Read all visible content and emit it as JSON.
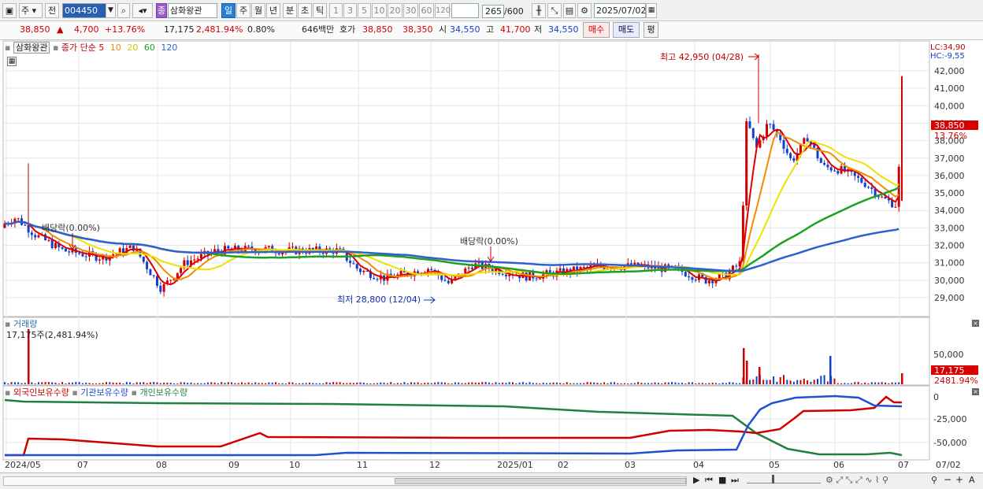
{
  "toolbar": {
    "market": "주",
    "prev": "전",
    "code": "004450",
    "badge": "종",
    "name": "삼화왕관",
    "periods": [
      "일",
      "주",
      "월",
      "년",
      "분",
      "초",
      "틱"
    ],
    "minutes": [
      "1",
      "3",
      "5",
      "10",
      "20",
      "30",
      "60",
      "120"
    ],
    "count": "265",
    "count_total": "/600",
    "date": "2025/07/02"
  },
  "quote": {
    "price": "38,850",
    "change_sign": "▲",
    "change": "4,700",
    "change_pct": "+13.76%",
    "volume": "17,175",
    "volume_pct": "2,481.94%",
    "turnover_pct": "0.80%",
    "amount": "646백만",
    "bid_label": "호가",
    "ask": "38,850",
    "bid": "38,350",
    "open_label": "시",
    "open": "34,550",
    "high_label": "고",
    "high": "41,700",
    "low_label": "저",
    "low": "34,550",
    "buy": "매수",
    "sell": "매도",
    "eval": "평"
  },
  "legend": {
    "name": "삼화왕관",
    "ma_label": "종가 단순",
    "ma_periods": [
      "5",
      "10",
      "20",
      "60",
      "120"
    ],
    "lc": "LC:34,90",
    "hc": "HC:-9,55"
  },
  "price_axis": [
    "42,000",
    "41,000",
    "40,000",
    "39,000",
    "38,000",
    "37,000",
    "36,000",
    "35,000",
    "34,000",
    "33,000",
    "32,000",
    "31,000",
    "30,000",
    "29,000"
  ],
  "annotations": {
    "high": "최고 42,950 (04/28)",
    "low": "최저 28,800 (12/04)",
    "div1": "배당락(0.00%)",
    "div2": "배당락(0.00%)"
  },
  "current_tag": {
    "price": "38,850",
    "pct": "13.76%"
  },
  "volume_panel": {
    "title": "거래량",
    "value": "17,175주(2,481.94%)",
    "axis": "50,000",
    "tag_value": "17,175",
    "tag_pct": "2481.94%"
  },
  "holder_panel": {
    "series": [
      "외국인보유수량",
      "기관보유수량",
      "개인보유수량"
    ],
    "axis": [
      "0",
      "-25,000",
      "-50,000"
    ]
  },
  "x_axis": [
    "2024/05",
    "07",
    "08",
    "09",
    "10",
    "11",
    "12",
    "2025/01",
    "02",
    "03",
    "04",
    "05",
    "06",
    "07"
  ],
  "x_right": "07/02",
  "colors": {
    "up": "#d00000",
    "down": "#1040d0",
    "ma5": "#dd0000",
    "ma10": "#f08c00",
    "ma20": "#f0e000",
    "ma60": "#20a020",
    "ma120": "#3060d0",
    "foreign": "#d00000",
    "inst": "#2050d0",
    "indiv": "#208040"
  }
}
